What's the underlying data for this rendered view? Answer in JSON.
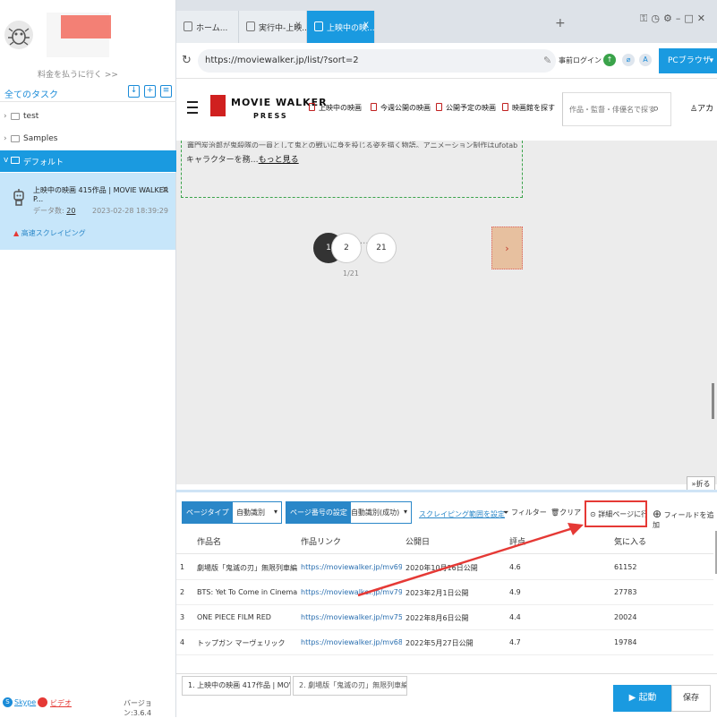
{
  "sidebar": {
    "pay_link": "料金を払うに行く >>",
    "all_tasks": "全てのタスク",
    "folders": [
      {
        "label": "test"
      },
      {
        "label": "Samples"
      },
      {
        "label": "デフォルト"
      }
    ],
    "task": {
      "title": "上映中の映画 415作品 | MOVIE WALKER P...",
      "count_label": "データ数:",
      "count": "20",
      "date": "2023-02-28 18:39:29",
      "speed": "高速スクレイピング",
      "close": "X"
    },
    "footer": {
      "skype": "Skype",
      "video": "ビデオ",
      "version": "バージョン:3.6.4"
    }
  },
  "tabs": [
    {
      "label": "ホーム...",
      "close": ""
    },
    {
      "label": "実行中-上映...",
      "close": "X"
    },
    {
      "label": "上映中の映...",
      "close": "X"
    }
  ],
  "address": {
    "url": "https://moviewalker.jp/list/?sort=2",
    "prelogin": "事前ログイン",
    "pc_browser": "PCブラウザ"
  },
  "site": {
    "logo_line1": "MOVIE WALKER",
    "logo_line2": "PRESS",
    "nav": [
      "上映中の映画",
      "今週公開の映画",
      "公開予定の映画",
      "映画館を探す"
    ],
    "search_placeholder": "作品・監督・俳優名で探す",
    "account": "アカ",
    "desc_line1": "竈門炭治郎が鬼殺隊の一員として鬼との戦いに身を投じる姿を描く物語。アニメーション制作はufotableが担当し...",
    "desc_line2": "キャラクターを務",
    "more": "もっと見る",
    "pages": [
      "1",
      "2",
      "21"
    ],
    "page_dots": "...",
    "page_count": "1/21",
    "next": "›",
    "fold": "折る"
  },
  "toolbar": {
    "page_type_label": "ページタイプ",
    "page_type_value": "自動識別",
    "page_no_label": "ページ番号の設定",
    "page_no_value": "自動識別(成功)",
    "scrape_range": "スクレイピング範囲を設定",
    "filter": "フィルター",
    "clear": "クリア",
    "detail": "詳細ページに行く",
    "add_field": "フィールドを追加"
  },
  "table": {
    "headers": [
      "作品名",
      "作品リンク",
      "公開日",
      "評点",
      "気に入る"
    ],
    "rows": [
      {
        "n": "1",
        "title": "劇場版「鬼滅の刃」無限列車編",
        "link": "https://moviewalker.jp/mv69938/",
        "date": "2020年10月16日公開",
        "score": "4.6",
        "likes": "61152"
      },
      {
        "n": "2",
        "title": "BTS: Yet To Come in Cinemas",
        "link": "https://moviewalker.jp/mv79622/",
        "date": "2023年2月1日公開",
        "score": "4.9",
        "likes": "27783"
      },
      {
        "n": "3",
        "title": "ONE PIECE FILM RED",
        "link": "https://moviewalker.jp/mv75526/",
        "date": "2022年8月6日公開",
        "score": "4.4",
        "likes": "20024"
      },
      {
        "n": "4",
        "title": "トップガン マーヴェリック",
        "link": "https://moviewalker.jp/mv68446/",
        "date": "2022年5月27日公開",
        "score": "4.7",
        "likes": "19784"
      }
    ]
  },
  "bottom": {
    "tab1": "1. 上映中の映画 417作品 | MOVIE...",
    "tab2": "2. 劇場版「鬼滅の刃」無限列車編...",
    "run": "起動",
    "save": "保存"
  },
  "colors": {
    "accent": "#1a9ae0",
    "highlight": "#e53935",
    "brand": "#d0201f"
  }
}
